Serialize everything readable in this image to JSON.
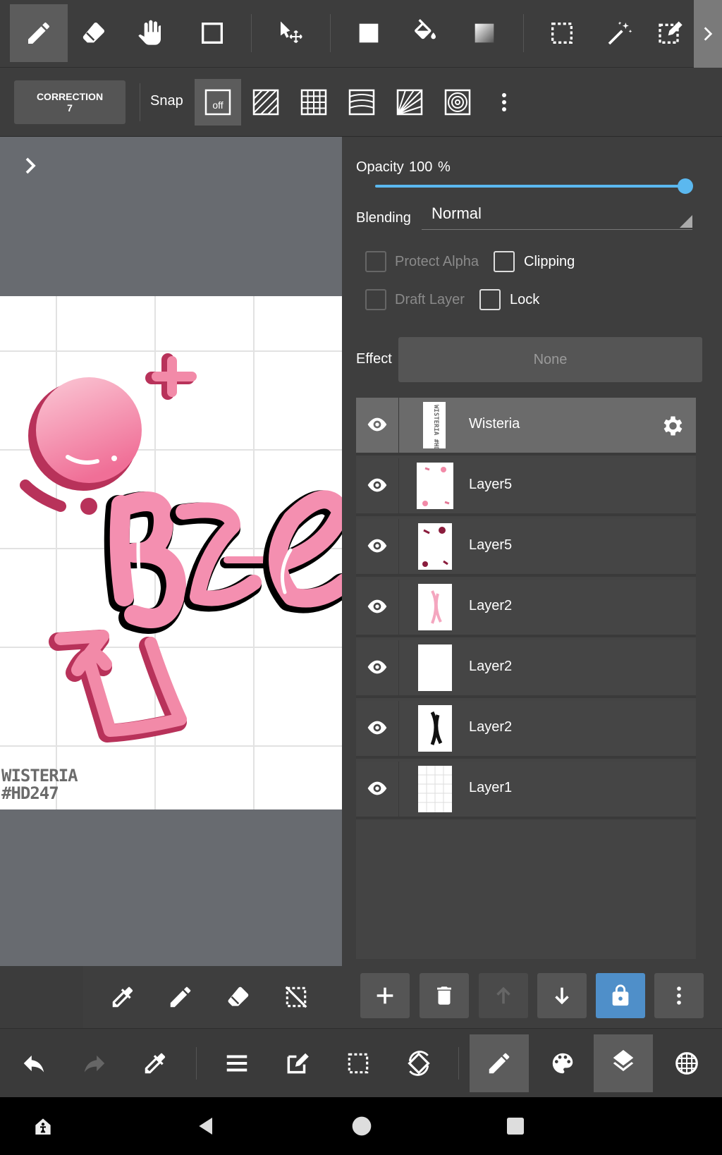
{
  "toolbar": {
    "correction_label": "CORRECTION",
    "correction_value": "7",
    "snap_label": "Snap",
    "snap_off_label": "off"
  },
  "layer_properties": {
    "opacity_label": "Opacity",
    "opacity_value": "100",
    "opacity_unit": "%",
    "opacity_fraction": 1.0,
    "blending_label": "Blending",
    "blending_value": "Normal",
    "protect_alpha_label": "Protect Alpha",
    "clipping_label": "Clipping",
    "draft_layer_label": "Draft Layer",
    "lock_label": "Lock",
    "effect_label": "Effect",
    "effect_value": "None"
  },
  "layers": [
    {
      "name": "Wisteria",
      "selected": true
    },
    {
      "name": "Layer5",
      "selected": false
    },
    {
      "name": "Layer5",
      "selected": false
    },
    {
      "name": "Layer2",
      "selected": false
    },
    {
      "name": "Layer2",
      "selected": false
    },
    {
      "name": "Layer2",
      "selected": false
    },
    {
      "name": "Layer1",
      "selected": false
    }
  ],
  "canvas": {
    "watermark_line1": "WISTERIA",
    "watermark_line2": "#HD247",
    "thumb_text": "WISTERIA #HD247"
  },
  "colors": {
    "accent_blue": "#5bb8ef",
    "lock_blue": "#4f8fc9",
    "pink": "#f28aa8",
    "dark_pink": "#b8325a"
  }
}
